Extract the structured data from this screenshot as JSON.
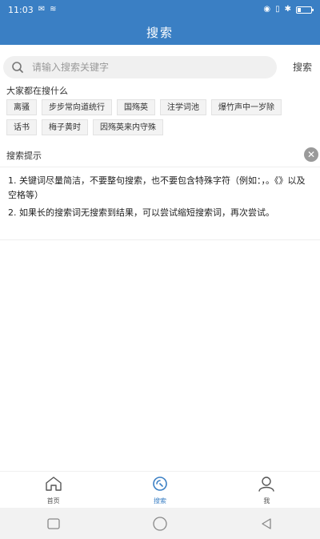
{
  "status_bar": {
    "time": "11:03",
    "icons": [
      "message-icon",
      "wifi-icon",
      "eye-icon",
      "vibrate-icon",
      "bluetooth-icon",
      "battery-icon"
    ]
  },
  "header": {
    "title": "搜索"
  },
  "search": {
    "placeholder": "请输入搜索关键字",
    "value": "",
    "button_label": "搜索"
  },
  "hot": {
    "title": "大家都在搜什么",
    "tags": [
      "离骚",
      "步步常向道统行",
      "国殇英",
      "注学词池",
      "爆竹声中一岁除",
      "话书",
      "梅子黄时",
      "因殇英来内守殊"
    ]
  },
  "tips": {
    "title": "搜索提示",
    "close_icon": "close-icon",
    "lines": [
      "1. 关键词尽量简洁，不要整句搜索，也不要包含特殊字符（例如：，。《》以及空格等）",
      "2. 如果长的搜索词无搜索到结果，可以尝试缩短搜索词，再次尝试。"
    ]
  },
  "bottom_nav": {
    "items": [
      {
        "label": "首页",
        "icon": "home-icon",
        "active": false
      },
      {
        "label": "搜索",
        "icon": "search-icon",
        "active": true
      },
      {
        "label": "我",
        "icon": "user-icon",
        "active": false
      }
    ]
  },
  "colors": {
    "primary": "#3a7fc4",
    "tag_bg": "#f3f3f3",
    "search_bg": "#f0f0f0"
  }
}
